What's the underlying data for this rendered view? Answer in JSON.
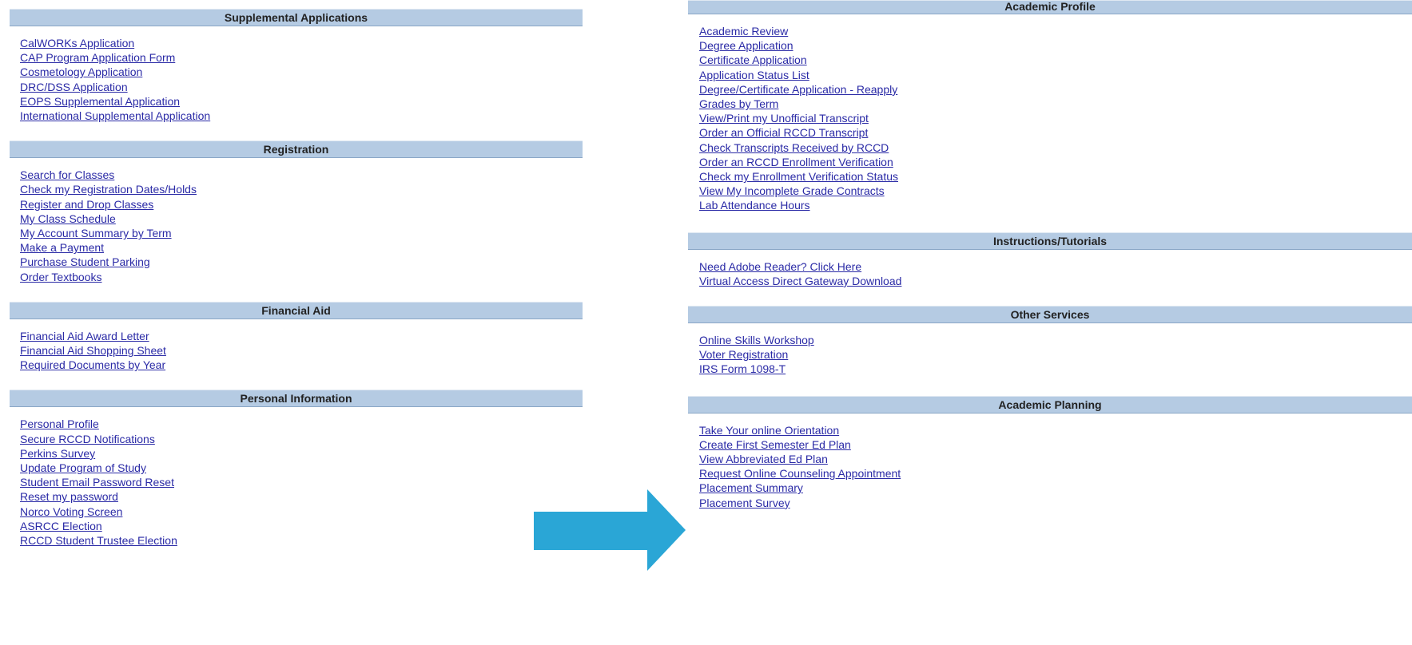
{
  "left_sections": [
    {
      "title": "Supplemental Applications",
      "links": [
        "CalWORKs Application",
        "CAP Program Application Form",
        "Cosmetology Application",
        "DRC/DSS Application",
        "EOPS Supplemental Application",
        "International Supplemental Application"
      ]
    },
    {
      "title": "Registration",
      "links": [
        "Search for Classes",
        "Check my Registration Dates/Holds",
        "Register and Drop Classes",
        "My Class Schedule",
        "My Account Summary by Term",
        "Make a Payment",
        "Purchase Student Parking",
        "Order Textbooks"
      ]
    },
    {
      "title": "Financial Aid",
      "links": [
        "Financial Aid Award Letter",
        "Financial Aid Shopping Sheet",
        "Required Documents by Year"
      ]
    },
    {
      "title": "Personal Information",
      "links": [
        "Personal Profile",
        "Secure RCCD Notifications",
        "Perkins Survey",
        "Update Program of Study",
        "Student Email Password Reset",
        "Reset my password",
        "Norco Voting Screen",
        "ASRCC Election",
        "RCCD Student Trustee Election"
      ]
    }
  ],
  "right_sections": [
    {
      "title": "Academic Profile",
      "links": [
        "Academic Review",
        "Degree Application",
        "Certificate Application",
        "Application Status List",
        "Degree/Certificate Application - Reapply",
        "Grades by Term",
        "View/Print my Unofficial Transcript",
        "Order an Official RCCD Transcript",
        "Check Transcripts Received by RCCD",
        "Order an RCCD Enrollment Verification",
        "Check my Enrollment Verification Status",
        "View My Incomplete Grade Contracts",
        "Lab Attendance Hours"
      ]
    },
    {
      "title": "Instructions/Tutorials",
      "links": [
        "Need Adobe Reader? Click Here",
        "Virtual Access Direct Gateway Download"
      ]
    },
    {
      "title": "Other Services",
      "links": [
        "Online Skills Workshop",
        "Voter Registration",
        "IRS Form 1098-T"
      ]
    },
    {
      "title": "Academic Planning",
      "links": [
        "Take Your online Orientation",
        "Create First Semester Ed Plan",
        "View Abbreviated Ed Plan",
        "Request Online Counseling Appointment",
        "Placement Summary",
        "Placement Survey"
      ]
    }
  ],
  "colors": {
    "header_bg": "#b5cbe3",
    "link": "#2a2aa6",
    "arrow": "#2aa6d6"
  },
  "arrow_icon": "arrow-right-icon"
}
